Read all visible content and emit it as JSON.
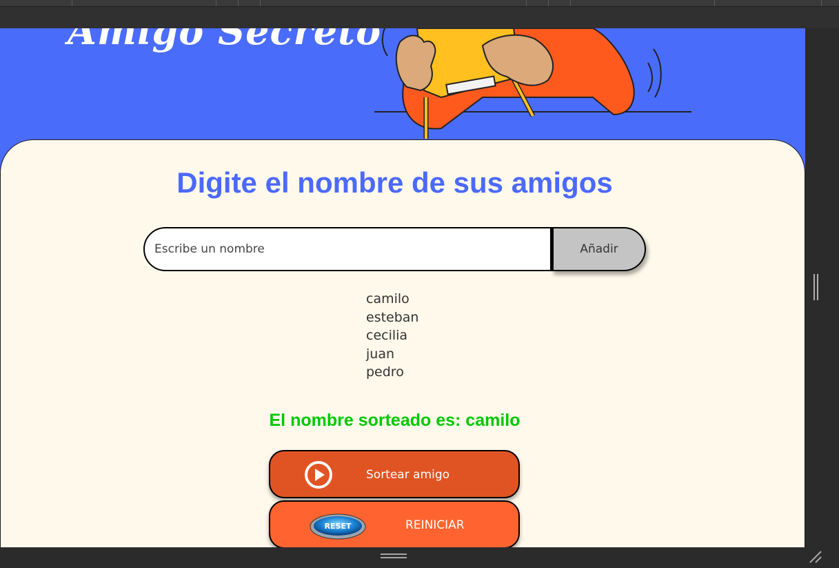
{
  "hero": {
    "title": "Amigo Secreto"
  },
  "form": {
    "heading": "Digite el nombre de sus amigos",
    "input_placeholder": "Escribe un nombre",
    "add_label": "Añadir"
  },
  "friends": [
    "camilo",
    "esteban",
    "cecilia",
    "juan",
    "pedro"
  ],
  "result": {
    "text": "El nombre sorteado es: camilo"
  },
  "buttons": {
    "draw_label": "Sortear amigo",
    "reset_label": "REINICIAR",
    "reset_badge": "RESET"
  },
  "colors": {
    "hero_bg": "#4a6cfa",
    "card_bg": "#fff9eb",
    "heading": "#4b69fd",
    "result": "#00c800",
    "draw_button": "#e05423",
    "reset_button": "#ff6430",
    "add_button": "#c4c4c4"
  },
  "icons": {
    "draw": "play-circle-icon",
    "reset": "reset-badge-icon"
  }
}
